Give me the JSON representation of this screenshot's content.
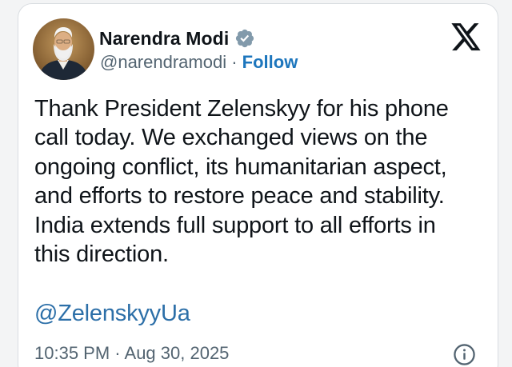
{
  "author": {
    "name": "Narendra Modi",
    "handle": "@narendramodi",
    "separator": " · ",
    "follow_label": "Follow",
    "verified": true
  },
  "tweet": {
    "text": "Thank President Zelenskyy for his phone\ncall today. We exchanged views on the\nongoing conflict, its humanitarian aspect,\nand efforts to restore peace and stability.\nIndia extends full support to all efforts in\nthis direction.",
    "mention": "@ZelenskyyUa",
    "time": "10:35 PM",
    "date_separator": " · ",
    "date": "Aug 30, 2025"
  },
  "icons": {
    "verified": "verified-badge-icon",
    "platform": "x-logo-icon",
    "info": "info-icon"
  },
  "colors": {
    "follow": "#1d76bd",
    "mention": "#2c6fa8",
    "verified_badge": "#829aab",
    "secondary_text": "#536471"
  }
}
